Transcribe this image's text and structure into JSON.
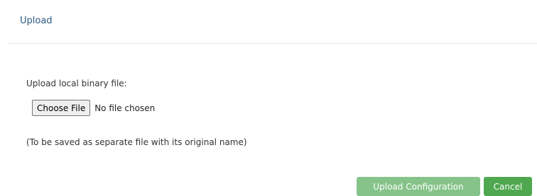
{
  "header": {
    "title": "Upload"
  },
  "body": {
    "upload_label": "Upload local binary file:",
    "choose_file_label": "Choose File",
    "file_status": "No file chosen",
    "hint": "(To be saved as separate file with its original name)"
  },
  "footer": {
    "upload_button_label": "Upload Configuration",
    "cancel_button_label": "Cancel"
  },
  "colors": {
    "title": "#2b5b84",
    "upload_button_bg": "#86c38a",
    "cancel_button_bg": "#4fa84f",
    "divider": "#e6e6e6"
  }
}
